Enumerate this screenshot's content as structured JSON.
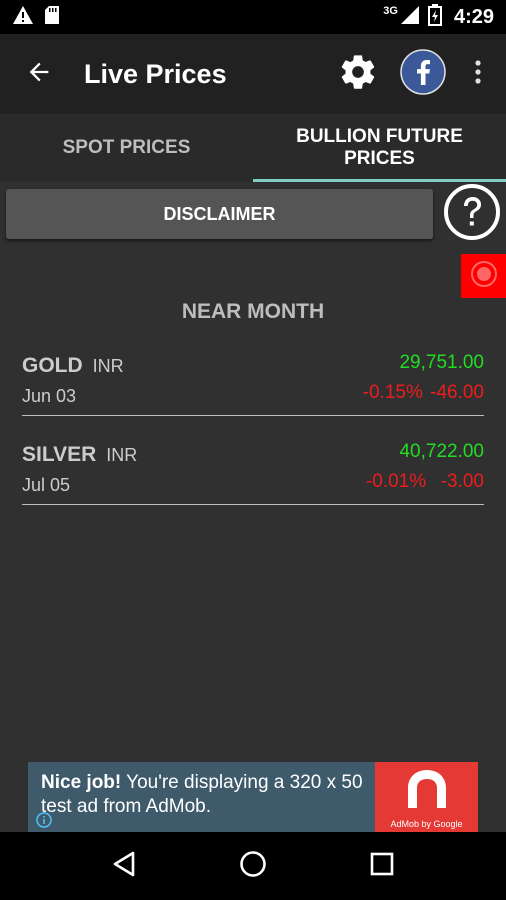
{
  "status_bar": {
    "network": "3G",
    "time": "4:29"
  },
  "app_bar": {
    "title": "Live Prices"
  },
  "tabs": [
    {
      "label": "SPOT PRICES",
      "active": false
    },
    {
      "label": "BULLION FUTURE\nPRICES",
      "active": true
    }
  ],
  "disclaimer": {
    "label": "DISCLAIMER"
  },
  "section": {
    "title": "NEAR MONTH"
  },
  "rows": [
    {
      "name": "GOLD",
      "currency": "INR",
      "date": "Jun 03",
      "price": "29,751.00",
      "change": "-0.15% -46.00"
    },
    {
      "name": "SILVER",
      "currency": "INR",
      "date": "Jul 05",
      "price": "40,722.00",
      "change": "-0.01%  -3.00"
    }
  ],
  "ad": {
    "bold": "Nice job!",
    "text": " You're displaying a 320 x 50 test ad from AdMob.",
    "logo_caption": "AdMob by Google"
  },
  "colors": {
    "price_up": "#22dd22",
    "price_down": "#ee1c1c",
    "tab_indicator": "#80cbc4",
    "record_button": "#ff0000"
  },
  "icons": [
    "alert-icon",
    "sd-card-icon",
    "signal-icon",
    "battery-icon",
    "back-arrow-icon",
    "gear-icon",
    "facebook-icon",
    "more-vert-icon",
    "help-icon",
    "record-icon",
    "info-icon",
    "admob-logo-icon",
    "nav-back-icon",
    "nav-home-icon",
    "nav-recents-icon"
  ]
}
